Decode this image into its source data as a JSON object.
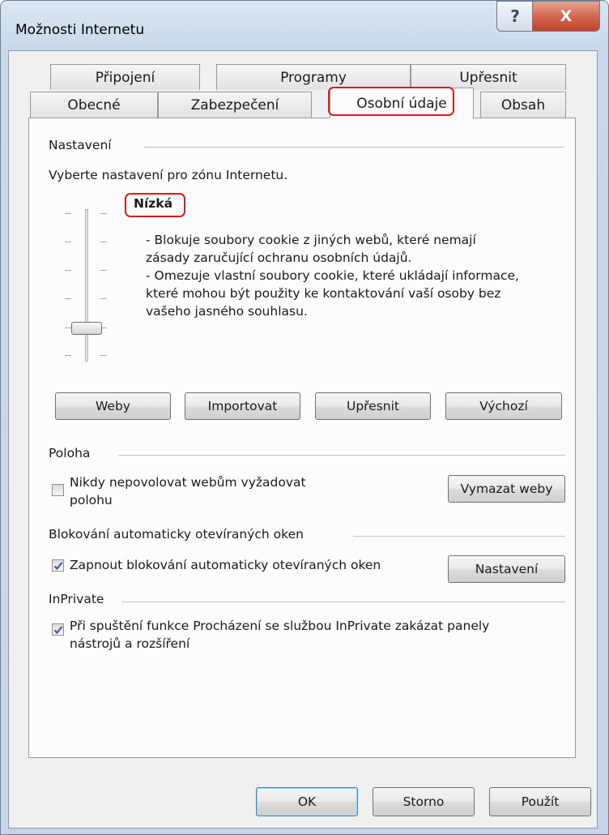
{
  "window": {
    "title": "Možnosti Internetu",
    "help_glyph": "?",
    "close_glyph": "X"
  },
  "tabs": {
    "row1": [
      "Připojení",
      "Programy",
      "Upřesnit"
    ],
    "row2": [
      "Obecné",
      "Zabezpečení",
      "Osobní údaje",
      "Obsah"
    ],
    "active": "Osobní údaje"
  },
  "settings": {
    "section_label": "Nastavení",
    "zone_prompt": "Vyberte nastavení pro zónu Internetu.",
    "level_name": "Nízká",
    "level_index": 2,
    "level_count": 6,
    "description_lines": [
      "- Blokuje soubory cookie z jiných webů, které nemají",
      "zásady zaručující ochranu osobních údajů.",
      "- Omezuje vlastní soubory cookie, které ukládají informace,",
      "které mohou být použity ke kontaktování vaší osoby bez",
      "vašeho jasného souhlasu."
    ],
    "buttons": {
      "sites": "Weby",
      "import": "Importovat",
      "advanced": "Upřesnit",
      "default": "Výchozí"
    }
  },
  "location": {
    "section_label": "Poloha",
    "checkbox_line1": "Nikdy nepovolovat webům vyžadovat",
    "checkbox_line2": "polohu",
    "checked": false,
    "clear_button": "Vymazat weby"
  },
  "popup": {
    "section_label": "Blokování automaticky otevíraných oken",
    "checkbox_label": "Zapnout blokování automaticky otevíraných oken",
    "checked": true,
    "settings_button": "Nastavení"
  },
  "inprivate": {
    "section_label": "InPrivate",
    "checkbox_line1": "Při spuštění funkce Procházení se službou InPrivate zakázat panely",
    "checkbox_line2": "nástrojů a rozšíření",
    "checked": true
  },
  "footer": {
    "ok": "OK",
    "cancel": "Storno",
    "apply": "Použít"
  },
  "colors": {
    "highlight_outline": "#d81d1d",
    "check_mark": "#3d5a9b"
  }
}
